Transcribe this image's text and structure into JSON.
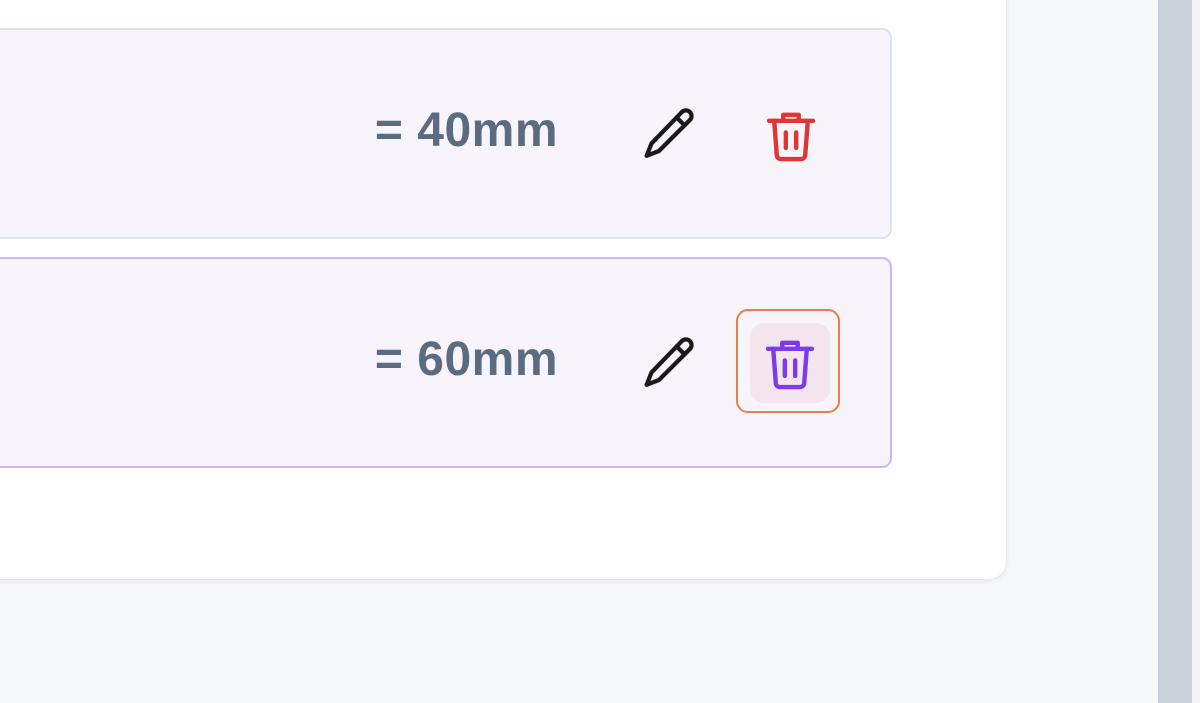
{
  "colors": {
    "page_background": "#f7f8fa",
    "card_background": "#ffffff",
    "row_background": "#f7f4fc",
    "value_text": "#5b6b80",
    "edit_icon": "#1a1a1a",
    "delete_icon": "#e03535",
    "delete_icon_active": "#7c3aed",
    "delete_hover_bg": "#f3e4ee",
    "focus_ring": "#f07c45",
    "selected_row_border": "#cdb8f6"
  },
  "rows": [
    {
      "value": "= 40mm",
      "edit_icon": "pencil-icon",
      "delete_icon": "trash-icon",
      "selected": false
    },
    {
      "value": "= 60mm",
      "edit_icon": "pencil-icon",
      "delete_icon": "trash-icon",
      "selected": true
    }
  ]
}
